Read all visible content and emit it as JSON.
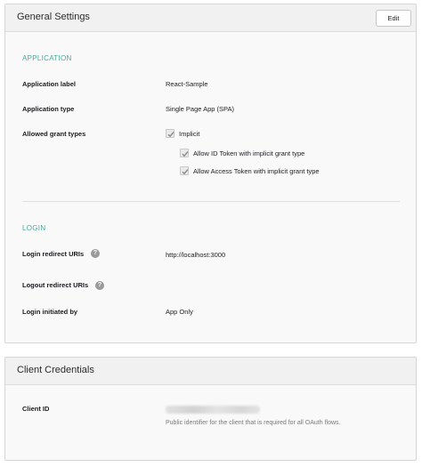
{
  "general": {
    "title": "General Settings",
    "edit_label": "Edit",
    "application": {
      "heading": "APPLICATION",
      "label_label": "Application label",
      "label_value": "React-Sample",
      "type_label": "Application type",
      "type_value": "Single Page App (SPA)",
      "grant_label": "Allowed grant types",
      "grants": [
        {
          "label": "Implicit",
          "checked": true
        },
        {
          "label": "Allow ID Token with implicit grant type",
          "checked": true
        },
        {
          "label": "Allow Access Token with implicit grant type",
          "checked": true
        }
      ]
    },
    "login": {
      "heading": "LOGIN",
      "redirect_label": "Login redirect URIs",
      "redirect_value": "http://localhost:3000",
      "logout_label": "Logout redirect URIs",
      "logout_value": "",
      "initiated_label": "Login initiated by",
      "initiated_value": "App Only",
      "help_icon_glyph": "?"
    }
  },
  "credentials": {
    "title": "Client Credentials",
    "client_id_label": "Client ID",
    "client_id_hint": "Public identifier for the client that is required for all OAuth flows."
  },
  "colors": {
    "accent_heading": "#4aa99a",
    "panel_bg": "#f9f9f9",
    "header_bg": "#f1f1f1"
  },
  "icons": {
    "check": "checkmark-icon",
    "help": "question-circle-icon"
  }
}
